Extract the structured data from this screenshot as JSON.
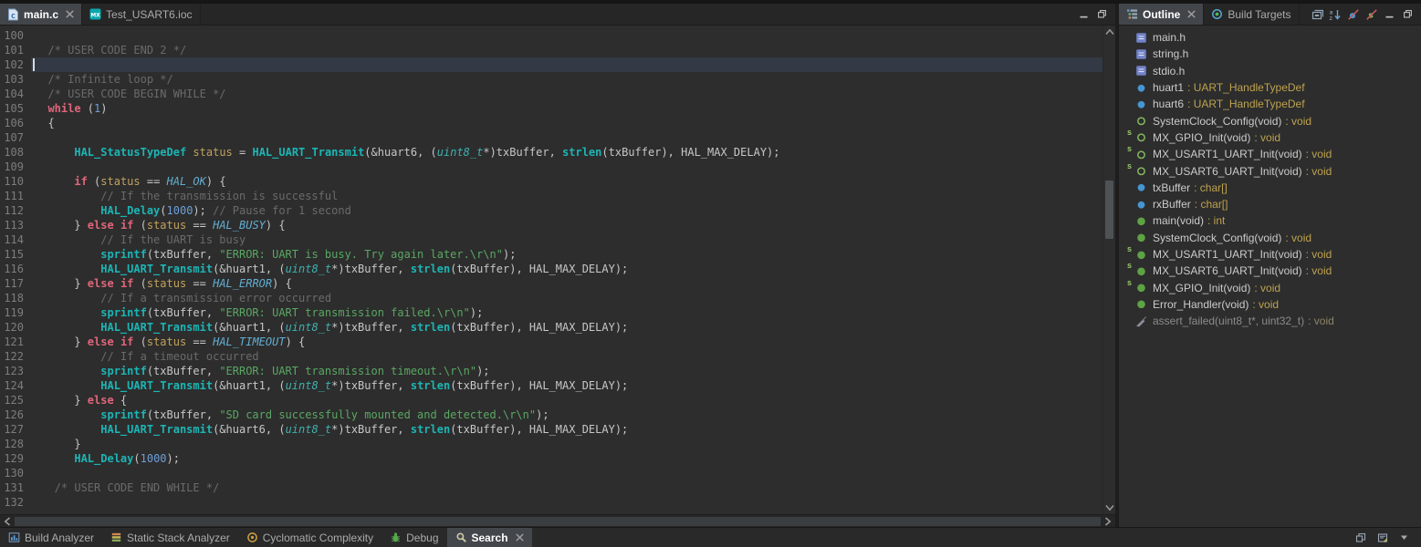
{
  "colors": {
    "editor_background": "#2d2d2d",
    "current_line_highlight": "#333a46",
    "keyword_pink": "#e0657a",
    "function_teal": "#1cb5b5",
    "string_green": "#5aa763",
    "comment_gray": "#6a6a6a",
    "number_blue": "#6e9fd6",
    "enum_blue": "#62aed2",
    "variable_tan": "#c2a25c",
    "outline_type_gold": "#bda24e"
  },
  "editor": {
    "tabs": [
      {
        "label": "main.c",
        "icon": "c-file-icon",
        "active": true,
        "closable": true
      },
      {
        "label": "Test_USART6.ioc",
        "icon": "ioc-file-icon",
        "active": false,
        "closable": false
      }
    ],
    "window_icons": [
      "minimize-icon",
      "restore-icon"
    ],
    "current_line": 102,
    "lines": [
      {
        "n": 100,
        "t": []
      },
      {
        "n": 101,
        "t": [
          [
            "c",
            "  /* USER CODE END 2 */"
          ]
        ]
      },
      {
        "n": 102,
        "t": []
      },
      {
        "n": 103,
        "t": [
          [
            "c",
            "  /* Infinite loop */"
          ]
        ]
      },
      {
        "n": 104,
        "t": [
          [
            "c",
            "  /* USER CODE BEGIN WHILE */"
          ]
        ]
      },
      {
        "n": 105,
        "t": [
          [
            "d",
            "  "
          ],
          [
            "k",
            "while"
          ],
          [
            "d",
            " ("
          ],
          [
            "n",
            "1"
          ],
          [
            "d",
            ")"
          ]
        ]
      },
      {
        "n": 106,
        "t": [
          [
            "d",
            "  {"
          ]
        ]
      },
      {
        "n": 107,
        "t": []
      },
      {
        "n": 108,
        "t": [
          [
            "d",
            "      "
          ],
          [
            "f",
            "HAL_StatusTypeDef"
          ],
          [
            "d",
            " "
          ],
          [
            "v",
            "status"
          ],
          [
            "d",
            " = "
          ],
          [
            "f",
            "HAL_UART_Transmit"
          ],
          [
            "d",
            "(&huart6, ("
          ],
          [
            "t",
            "uint8_t"
          ],
          [
            "d",
            "*)txBuffer, "
          ],
          [
            "f",
            "strlen"
          ],
          [
            "d",
            "(txBuffer), HAL_MAX_DELAY);"
          ]
        ]
      },
      {
        "n": 109,
        "t": []
      },
      {
        "n": 110,
        "t": [
          [
            "d",
            "      "
          ],
          [
            "k",
            "if"
          ],
          [
            "d",
            " ("
          ],
          [
            "v",
            "status"
          ],
          [
            "d",
            " == "
          ],
          [
            "e",
            "HAL_OK"
          ],
          [
            "d",
            ") {"
          ]
        ]
      },
      {
        "n": 111,
        "t": [
          [
            "c",
            "          // If the transmission is successful"
          ]
        ]
      },
      {
        "n": 112,
        "t": [
          [
            "d",
            "          "
          ],
          [
            "f",
            "HAL_Delay"
          ],
          [
            "d",
            "("
          ],
          [
            "n",
            "1000"
          ],
          [
            "d",
            "); "
          ],
          [
            "c",
            "// Pause for 1 second"
          ]
        ]
      },
      {
        "n": 113,
        "t": [
          [
            "d",
            "      } "
          ],
          [
            "k",
            "else"
          ],
          [
            "d",
            " "
          ],
          [
            "k",
            "if"
          ],
          [
            "d",
            " ("
          ],
          [
            "v",
            "status"
          ],
          [
            "d",
            " == "
          ],
          [
            "e",
            "HAL_BUSY"
          ],
          [
            "d",
            ") {"
          ]
        ]
      },
      {
        "n": 114,
        "t": [
          [
            "c",
            "          // If the UART is busy"
          ]
        ]
      },
      {
        "n": 115,
        "t": [
          [
            "d",
            "          "
          ],
          [
            "f",
            "sprintf"
          ],
          [
            "d",
            "(txBuffer, "
          ],
          [
            "s",
            "\"ERROR: UART is busy. Try again later.\\r\\n\""
          ],
          [
            "d",
            ");"
          ]
        ]
      },
      {
        "n": 116,
        "t": [
          [
            "d",
            "          "
          ],
          [
            "f",
            "HAL_UART_Transmit"
          ],
          [
            "d",
            "(&huart1, ("
          ],
          [
            "t",
            "uint8_t"
          ],
          [
            "d",
            "*)txBuffer, "
          ],
          [
            "f",
            "strlen"
          ],
          [
            "d",
            "(txBuffer), HAL_MAX_DELAY);"
          ]
        ]
      },
      {
        "n": 117,
        "t": [
          [
            "d",
            "      } "
          ],
          [
            "k",
            "else"
          ],
          [
            "d",
            " "
          ],
          [
            "k",
            "if"
          ],
          [
            "d",
            " ("
          ],
          [
            "v",
            "status"
          ],
          [
            "d",
            " == "
          ],
          [
            "e",
            "HAL_ERROR"
          ],
          [
            "d",
            ") {"
          ]
        ]
      },
      {
        "n": 118,
        "t": [
          [
            "c",
            "          // If a transmission error occurred"
          ]
        ]
      },
      {
        "n": 119,
        "t": [
          [
            "d",
            "          "
          ],
          [
            "f",
            "sprintf"
          ],
          [
            "d",
            "(txBuffer, "
          ],
          [
            "s",
            "\"ERROR: UART transmission failed.\\r\\n\""
          ],
          [
            "d",
            ");"
          ]
        ]
      },
      {
        "n": 120,
        "t": [
          [
            "d",
            "          "
          ],
          [
            "f",
            "HAL_UART_Transmit"
          ],
          [
            "d",
            "(&huart1, ("
          ],
          [
            "t",
            "uint8_t"
          ],
          [
            "d",
            "*)txBuffer, "
          ],
          [
            "f",
            "strlen"
          ],
          [
            "d",
            "(txBuffer), HAL_MAX_DELAY);"
          ]
        ]
      },
      {
        "n": 121,
        "t": [
          [
            "d",
            "      } "
          ],
          [
            "k",
            "else"
          ],
          [
            "d",
            " "
          ],
          [
            "k",
            "if"
          ],
          [
            "d",
            " ("
          ],
          [
            "v",
            "status"
          ],
          [
            "d",
            " == "
          ],
          [
            "e",
            "HAL_TIMEOUT"
          ],
          [
            "d",
            ") {"
          ]
        ]
      },
      {
        "n": 122,
        "t": [
          [
            "c",
            "          // If a timeout occurred"
          ]
        ]
      },
      {
        "n": 123,
        "t": [
          [
            "d",
            "          "
          ],
          [
            "f",
            "sprintf"
          ],
          [
            "d",
            "(txBuffer, "
          ],
          [
            "s",
            "\"ERROR: UART transmission timeout.\\r\\n\""
          ],
          [
            "d",
            ");"
          ]
        ]
      },
      {
        "n": 124,
        "t": [
          [
            "d",
            "          "
          ],
          [
            "f",
            "HAL_UART_Transmit"
          ],
          [
            "d",
            "(&huart1, ("
          ],
          [
            "t",
            "uint8_t"
          ],
          [
            "d",
            "*)txBuffer, "
          ],
          [
            "f",
            "strlen"
          ],
          [
            "d",
            "(txBuffer), HAL_MAX_DELAY);"
          ]
        ]
      },
      {
        "n": 125,
        "t": [
          [
            "d",
            "      } "
          ],
          [
            "k",
            "else"
          ],
          [
            "d",
            " {"
          ]
        ]
      },
      {
        "n": 126,
        "t": [
          [
            "d",
            "          "
          ],
          [
            "f",
            "sprintf"
          ],
          [
            "d",
            "(txBuffer, "
          ],
          [
            "s",
            "\"SD card successfully mounted and detected.\\r\\n\""
          ],
          [
            "d",
            ");"
          ]
        ]
      },
      {
        "n": 127,
        "t": [
          [
            "d",
            "          "
          ],
          [
            "f",
            "HAL_UART_Transmit"
          ],
          [
            "d",
            "(&huart6, ("
          ],
          [
            "t",
            "uint8_t"
          ],
          [
            "d",
            "*)txBuffer, "
          ],
          [
            "f",
            "strlen"
          ],
          [
            "d",
            "(txBuffer), HAL_MAX_DELAY);"
          ]
        ]
      },
      {
        "n": 128,
        "t": [
          [
            "d",
            "      }"
          ]
        ]
      },
      {
        "n": 129,
        "t": [
          [
            "d",
            "      "
          ],
          [
            "f",
            "HAL_Delay"
          ],
          [
            "d",
            "("
          ],
          [
            "n",
            "1000"
          ],
          [
            "d",
            ");"
          ]
        ]
      },
      {
        "n": 130,
        "t": []
      },
      {
        "n": 131,
        "t": [
          [
            "c",
            "   /* USER CODE END WHILE */"
          ]
        ]
      },
      {
        "n": 132,
        "t": []
      }
    ]
  },
  "outline_panel": {
    "tabs": [
      {
        "label": "Outline",
        "icon": "outline-icon",
        "active": true,
        "closable": true
      },
      {
        "label": "Build Targets",
        "icon": "target-icon",
        "active": false,
        "closable": false
      }
    ],
    "toolbar_icons": [
      "collapse-all-icon",
      "sort-icon",
      "hide-fields-icon",
      "hide-static-icon",
      "minimize-icon",
      "restore-icon"
    ],
    "items": [
      {
        "icon": "include-icon",
        "name": "main.h",
        "type": ""
      },
      {
        "icon": "include-icon",
        "name": "string.h",
        "type": ""
      },
      {
        "icon": "include-icon",
        "name": "stdio.h",
        "type": ""
      },
      {
        "icon": "field-icon",
        "name": "huart1",
        "type": ": UART_HandleTypeDef"
      },
      {
        "icon": "field-icon",
        "name": "huart6",
        "type": ": UART_HandleTypeDef"
      },
      {
        "icon": "func-decl-icon",
        "name": "SystemClock_Config(void)",
        "type": ": void"
      },
      {
        "icon": "func-decl-icon",
        "static": true,
        "name": "MX_GPIO_Init(void)",
        "type": ": void"
      },
      {
        "icon": "func-decl-icon",
        "static": true,
        "name": "MX_USART1_UART_Init(void)",
        "type": ": void"
      },
      {
        "icon": "func-decl-icon",
        "static": true,
        "name": "MX_USART6_UART_Init(void)",
        "type": ": void"
      },
      {
        "icon": "field-icon",
        "name": "txBuffer",
        "type": ": char[]"
      },
      {
        "icon": "field-icon",
        "name": "rxBuffer",
        "type": ": char[]"
      },
      {
        "icon": "func-icon",
        "name": "main(void)",
        "type": ": int"
      },
      {
        "icon": "func-icon",
        "name": "SystemClock_Config(void)",
        "type": ": void"
      },
      {
        "icon": "func-icon",
        "static": true,
        "name": "MX_USART1_UART_Init(void)",
        "type": ": void"
      },
      {
        "icon": "func-icon",
        "static": true,
        "name": "MX_USART6_UART_Init(void)",
        "type": ": void"
      },
      {
        "icon": "func-icon",
        "static": true,
        "name": "MX_GPIO_Init(void)",
        "type": ": void"
      },
      {
        "icon": "func-icon",
        "name": "Error_Handler(void)",
        "type": ": void"
      },
      {
        "icon": "inactive-icon",
        "name": "assert_failed(uint8_t*, uint32_t)",
        "type": ": void",
        "dim": true
      }
    ]
  },
  "bottom_bar": {
    "tabs": [
      {
        "label": "Build Analyzer",
        "icon": "build-analyzer-icon",
        "active": false,
        "closable": false
      },
      {
        "label": "Static Stack Analyzer",
        "icon": "stack-analyzer-icon",
        "active": false,
        "closable": false
      },
      {
        "label": "Cyclomatic Complexity",
        "icon": "cyclomatic-icon",
        "active": false,
        "closable": false
      },
      {
        "label": "Debug",
        "icon": "debug-icon",
        "active": false,
        "closable": false
      },
      {
        "label": "Search",
        "icon": "search-icon",
        "active": true,
        "closable": true
      }
    ],
    "right_icons": [
      "restore-view-icon",
      "pin-editor-icon",
      "overflow-menu-icon"
    ]
  }
}
